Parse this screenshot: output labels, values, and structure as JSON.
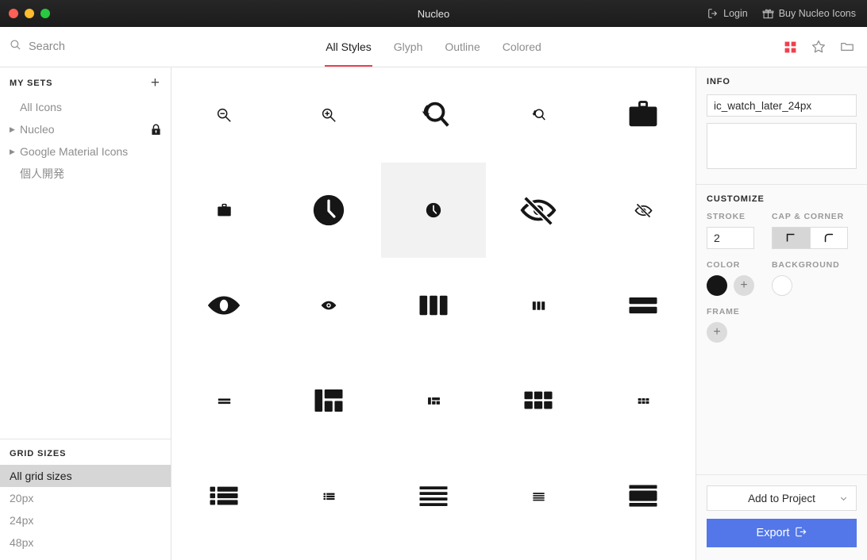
{
  "window": {
    "title": "Nucleo",
    "traffic_lights": [
      "close",
      "minimize",
      "maximize"
    ],
    "login_label": "Login",
    "buy_label": "Buy Nucleo Icons"
  },
  "search": {
    "placeholder": "Search",
    "value": ""
  },
  "tabs": [
    {
      "label": "All Styles",
      "active": true
    },
    {
      "label": "Glyph",
      "active": false
    },
    {
      "label": "Outline",
      "active": false
    },
    {
      "label": "Colored",
      "active": false
    }
  ],
  "top_icons": [
    {
      "name": "grid-view-icon",
      "active": true,
      "color": "#f0404d"
    },
    {
      "name": "star-icon",
      "active": false,
      "color": "#8d8d8d"
    },
    {
      "name": "folder-icon",
      "active": false,
      "color": "#8d8d8d"
    }
  ],
  "sidebar": {
    "my_sets_title": "MY SETS",
    "add_label": "+",
    "items": [
      {
        "label": "All Icons",
        "expandable": false,
        "locked": false
      },
      {
        "label": "Nucleo",
        "expandable": true,
        "locked": true
      },
      {
        "label": "Google Material Icons",
        "expandable": true,
        "locked": false
      },
      {
        "label": "個人開発",
        "expandable": false,
        "locked": false
      }
    ],
    "grid_sizes_title": "GRID SIZES",
    "grid_sizes": [
      {
        "label": "All grid sizes",
        "selected": true
      },
      {
        "label": "20px",
        "selected": false
      },
      {
        "label": "24px",
        "selected": false
      },
      {
        "label": "48px",
        "selected": false
      }
    ]
  },
  "icon_grid": {
    "columns": 5,
    "icons": [
      {
        "name": "zoom-out-icon",
        "selected": false
      },
      {
        "name": "zoom-in-icon",
        "selected": false
      },
      {
        "name": "zoom-reset-large-icon",
        "selected": false
      },
      {
        "name": "zoom-reset-small-icon",
        "selected": false
      },
      {
        "name": "briefcase-large-icon",
        "selected": false
      },
      {
        "name": "briefcase-small-icon",
        "selected": false
      },
      {
        "name": "clock-large-icon",
        "selected": false
      },
      {
        "name": "clock-small-icon",
        "selected": true
      },
      {
        "name": "eye-off-large-icon",
        "selected": false
      },
      {
        "name": "eye-off-small-icon",
        "selected": false
      },
      {
        "name": "eye-large-icon",
        "selected": false
      },
      {
        "name": "eye-small-icon",
        "selected": false
      },
      {
        "name": "columns-three-large-icon",
        "selected": false
      },
      {
        "name": "columns-three-small-icon",
        "selected": false
      },
      {
        "name": "rows-two-large-icon",
        "selected": false
      },
      {
        "name": "rows-two-small-icon",
        "selected": false
      },
      {
        "name": "dashboard-layout-large-icon",
        "selected": false
      },
      {
        "name": "dashboard-layout-small-icon",
        "selected": false
      },
      {
        "name": "grid-six-large-icon",
        "selected": false
      },
      {
        "name": "grid-six-small-icon",
        "selected": false
      },
      {
        "name": "list-bulleted-large-icon",
        "selected": false
      },
      {
        "name": "list-bulleted-small-icon",
        "selected": false
      },
      {
        "name": "menu-lines-large-icon",
        "selected": false
      },
      {
        "name": "menu-lines-small-icon",
        "selected": false
      },
      {
        "name": "layout-header-footer-icon",
        "selected": false
      }
    ]
  },
  "info": {
    "title": "INFO",
    "name_value": "ic_watch_later_24px",
    "name_placeholder": "",
    "tags_value": "",
    "tags_placeholder": ""
  },
  "customize": {
    "title": "CUSTOMIZE",
    "stroke_label": "STROKE",
    "stroke_value": "2",
    "cap_corner_label": "CAP & CORNER",
    "cap_options": [
      {
        "name": "sharp-corner-icon",
        "selected": true
      },
      {
        "name": "round-corner-icon",
        "selected": false
      }
    ],
    "color_label": "COLOR",
    "color_value": "#161616",
    "color_add_label": "+",
    "background_label": "BACKGROUND",
    "background_value": "#ffffff",
    "frame_label": "FRAME",
    "frame_add_label": "+"
  },
  "footer": {
    "add_to_project_label": "Add to Project",
    "export_label": "Export",
    "export_accent": "#5377e8"
  }
}
